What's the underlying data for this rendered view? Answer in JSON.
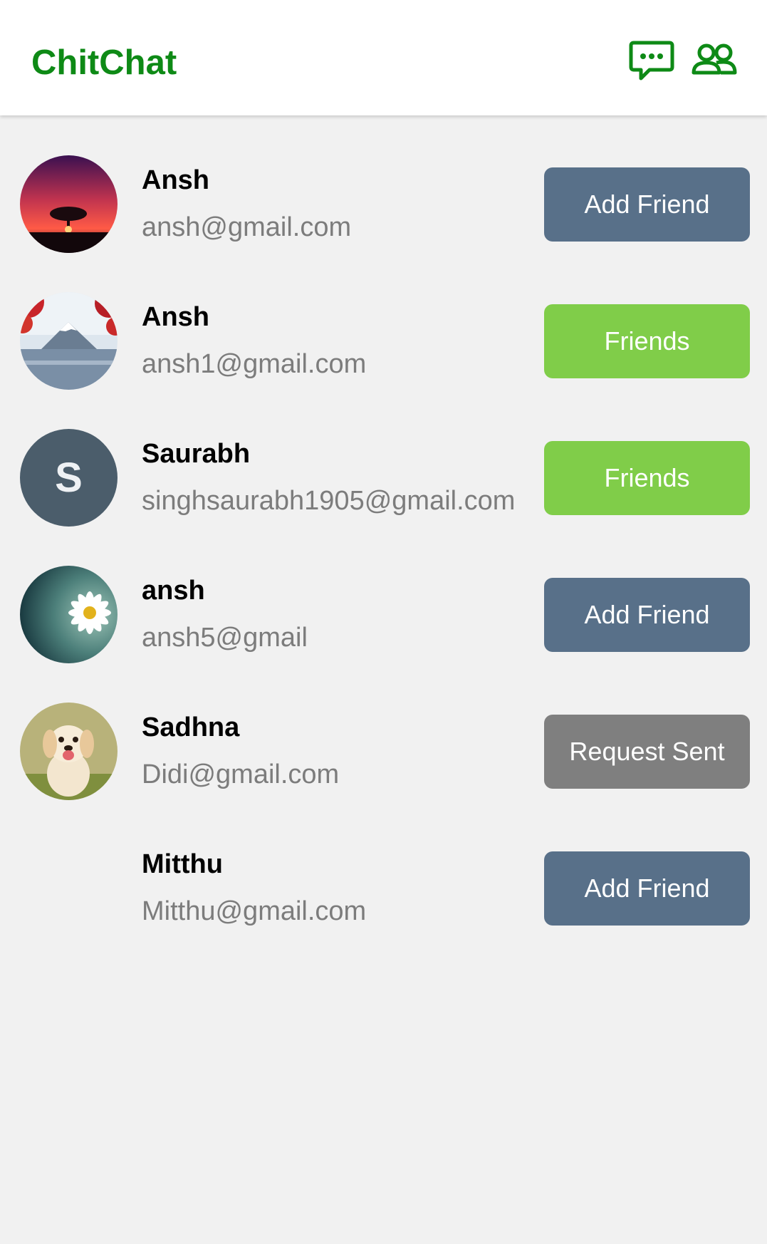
{
  "app": {
    "title": "ChitChat",
    "accent_color": "#0e8a16",
    "icons": [
      "chat-bubble-icon",
      "friends-icon"
    ]
  },
  "users": [
    {
      "name": "Ansh",
      "email": "ansh@gmail.com",
      "action": "Add Friend",
      "action_color": "#587089",
      "avatar": "sunset-tree-photo"
    },
    {
      "name": "Ansh",
      "email": "ansh1@gmail.com",
      "action": "Friends",
      "action_color": "#80cd49",
      "avatar": "mountain-lake-photo"
    },
    {
      "name": "Saurabh",
      "email": "singhsaurabh1905@gmail.com",
      "action": "Friends",
      "action_color": "#80cd49",
      "avatar_letter": "S"
    },
    {
      "name": "ansh",
      "email": "ansh5@gmail",
      "action": "Add Friend",
      "action_color": "#587089",
      "avatar": "daisy-photo"
    },
    {
      "name": "Sadhna",
      "email": "Didi@gmail.com",
      "action": "Request Sent",
      "action_color": "#7f7f7f",
      "avatar": "puppy-photo"
    },
    {
      "name": "Mitthu",
      "email": "Mitthu@gmail.com",
      "action": "Add Friend",
      "action_color": "#587089"
    }
  ]
}
